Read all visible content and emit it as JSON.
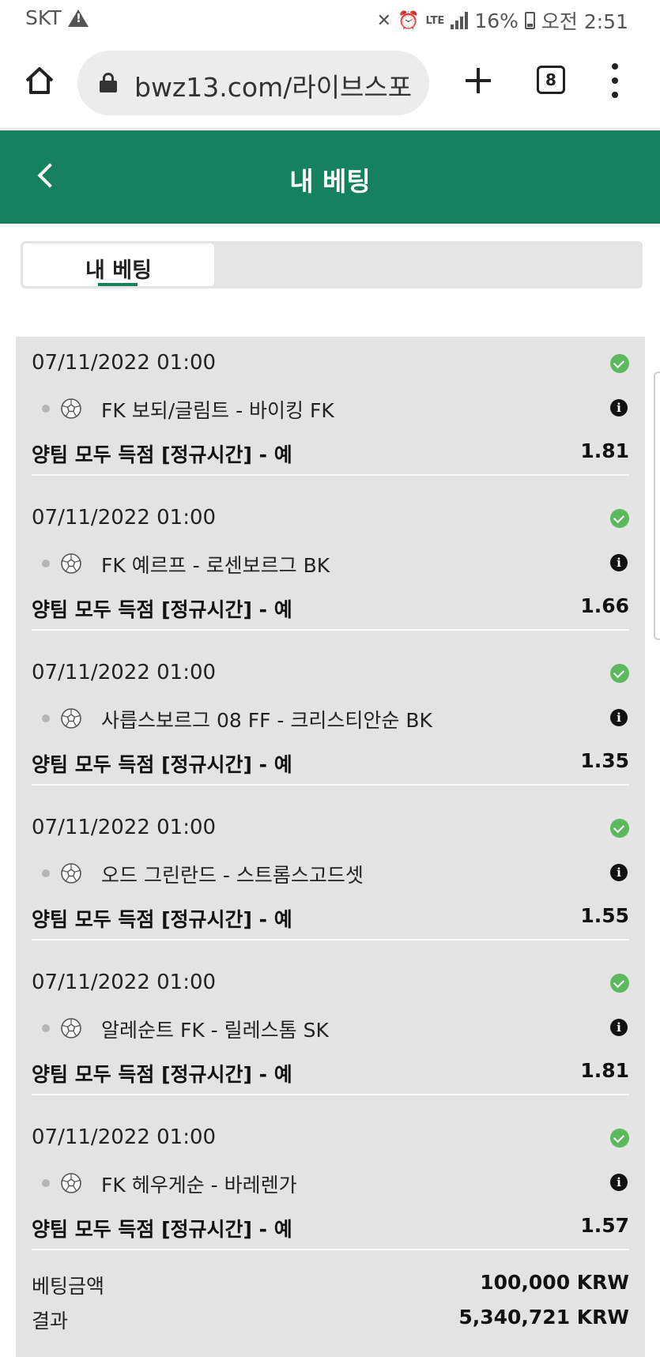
{
  "status_bar": {
    "carrier": "SKT",
    "lte": "LTE",
    "battery": "16%",
    "time": "오전 2:51"
  },
  "browser": {
    "url": "bwz13.com/라이브스포",
    "tab_count": "8"
  },
  "header": {
    "title": "내 베팅"
  },
  "tabs": [
    {
      "label": "내 베팅",
      "active": true
    }
  ],
  "bets": [
    {
      "date": "07/11/2022 01:00",
      "match": "FK 보되/글림트 - 바이킹 FK",
      "market": "양팀 모두 득점 [정규시간] - 예",
      "odds": "1.81"
    },
    {
      "date": "07/11/2022 01:00",
      "match": "FK 예르프 - 로센보르그 BK",
      "market": "양팀 모두 득점 [정규시간] - 예",
      "odds": "1.66"
    },
    {
      "date": "07/11/2022 01:00",
      "match": "사릅스보르그 08 FF - 크리스티안순 BK",
      "market": "양팀 모두 득점 [정규시간] - 예",
      "odds": "1.35"
    },
    {
      "date": "07/11/2022 01:00",
      "match": "오드 그린란드 - 스트롬스고드셋",
      "market": "양팀 모두 득점 [정규시간] - 예",
      "odds": "1.55"
    },
    {
      "date": "07/11/2022 01:00",
      "match": "알레순트 FK - 릴레스톰 SK",
      "market": "양팀 모두 득점 [정규시간] - 예",
      "odds": "1.81"
    },
    {
      "date": "07/11/2022 01:00",
      "match": "FK 헤우게순 - 바레렌가",
      "market": "양팀 모두 득점 [정규시간] - 예",
      "odds": "1.57"
    }
  ],
  "summary": {
    "stake_label": "베팅금액",
    "stake_value": "100,000 KRW",
    "result_label": "결과",
    "result_value": "5,340,721 KRW"
  },
  "colors": {
    "brand_green": "#15815e",
    "won_check": "#5cb85c",
    "list_bg": "#e3e3e3"
  }
}
